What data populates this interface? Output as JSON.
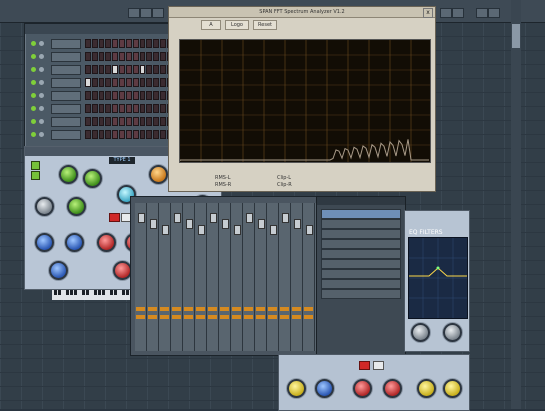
{
  "spectrum_window": {
    "title": "SPAN FFT Spectrum Analyzer V1.2",
    "tabs": [
      "A",
      "Logo",
      "Reset"
    ],
    "close_label": "x",
    "readouts": [
      "RMS-L",
      "RMS-R",
      "Clip-L",
      "Clip-R"
    ]
  },
  "synth_window": {
    "lcd_text": "TYPE 1"
  },
  "eq_window": {
    "label": "EQ FILTERS"
  },
  "colors": {
    "desktop": "#323e48",
    "spectrum_bg": "#120d05",
    "spectrum_grid": "#6b4a1e",
    "spectrum_line": "#a89a88",
    "knob_green": "#3f8f1b",
    "knob_orange": "#c8781b",
    "knob_blue": "#2b58b4",
    "knob_red": "#b22828",
    "knob_yellow": "#c9b01c",
    "step_on": "#d9d9d9"
  },
  "sequencer": {
    "rows": [
      {
        "led": "on",
        "steps": [
          0,
          0,
          0,
          0,
          0,
          0,
          0,
          0,
          0,
          0,
          0,
          0,
          0,
          0,
          0,
          0
        ]
      },
      {
        "led": "on",
        "steps": [
          0,
          0,
          0,
          0,
          0,
          0,
          0,
          0,
          0,
          0,
          0,
          0,
          0,
          0,
          0,
          0
        ]
      },
      {
        "led": "on",
        "steps": [
          0,
          0,
          0,
          0,
          1,
          0,
          0,
          0,
          1,
          0,
          0,
          0,
          1,
          0,
          0,
          0
        ]
      },
      {
        "led": "on",
        "steps": [
          1,
          0,
          0,
          0,
          0,
          0,
          0,
          0,
          0,
          0,
          0,
          0,
          0,
          0,
          0,
          0
        ]
      },
      {
        "led": "on",
        "steps": [
          0,
          0,
          0,
          0,
          0,
          0,
          0,
          0,
          0,
          0,
          0,
          0,
          0,
          0,
          0,
          0
        ]
      },
      {
        "led": "on",
        "steps": [
          0,
          0,
          0,
          0,
          0,
          0,
          0,
          0,
          0,
          0,
          0,
          0,
          0,
          0,
          0,
          0
        ]
      },
      {
        "led": "on",
        "steps": [
          0,
          0,
          0,
          0,
          0,
          0,
          0,
          0,
          0,
          0,
          0,
          0,
          0,
          0,
          0,
          0
        ]
      },
      {
        "led": "on",
        "steps": [
          0,
          0,
          0,
          0,
          0,
          0,
          0,
          0,
          0,
          0,
          0,
          0,
          0,
          0,
          0,
          0
        ]
      }
    ]
  },
  "mixer": {
    "strip_count": 16
  },
  "fx_panel": {
    "slot_count": 9
  },
  "icons": [
    "close-icon",
    "led-icon",
    "knob-icon",
    "fader-icon",
    "scroll-thumb-icon"
  ]
}
